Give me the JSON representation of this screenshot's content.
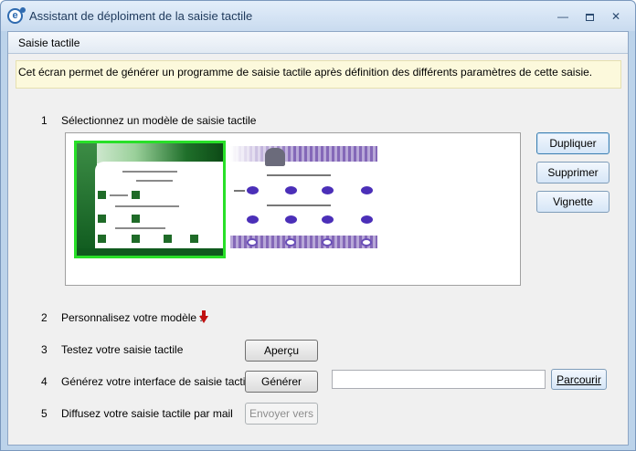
{
  "window": {
    "title": "Assistant de déploiment de la saisie tactile"
  },
  "header": {
    "title": "Saisie tactile"
  },
  "info": {
    "text": "Cet écran permet de générer un programme de saisie tactile après définition des différents paramètres de cette saisie."
  },
  "steps": [
    {
      "num": "1",
      "label": "Sélectionnez un modèle de saisie tactile"
    },
    {
      "num": "2",
      "label": "Personnalisez votre modèle :"
    },
    {
      "num": "3",
      "label": "Testez votre saisie tactile"
    },
    {
      "num": "4",
      "label": "Générez votre interface de saisie tactile"
    },
    {
      "num": "5",
      "label": "Diffusez votre saisie tactile par mail"
    }
  ],
  "side_buttons": {
    "duplicate": "Dupliquer",
    "delete": "Supprimer",
    "thumbnail": "Vignette"
  },
  "buttons": {
    "preview": "Aperçu",
    "generate": "Générer",
    "browse": "Parcourir",
    "send": "Envoyer vers"
  },
  "path_input": {
    "value": ""
  },
  "colors": {
    "selected_border": "#28e028",
    "info_background": "#fcf9dc",
    "arrow": "#c01010"
  },
  "icons": [
    "app-icon",
    "minimize-icon",
    "maximize-icon",
    "close-icon",
    "arrow-down-icon"
  ]
}
